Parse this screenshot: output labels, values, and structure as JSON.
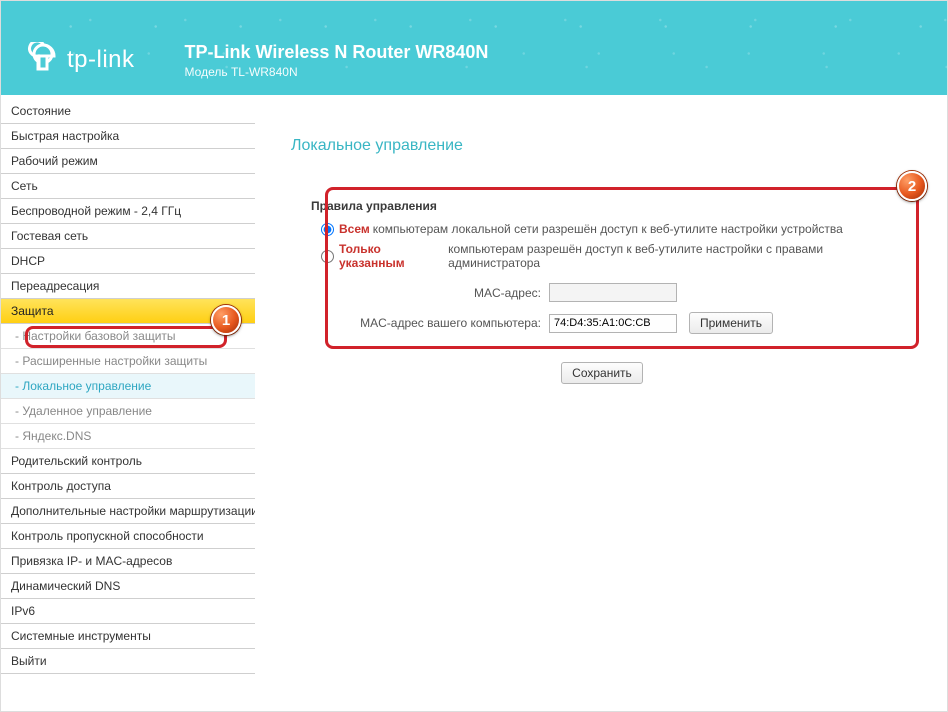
{
  "header": {
    "logo_text": "tp-link",
    "title": "TP-Link Wireless N Router WR840N",
    "subtitle": "Модель TL-WR840N"
  },
  "sidebar": {
    "items": [
      {
        "label": "Состояние",
        "type": "top"
      },
      {
        "label": "Быстрая настройка",
        "type": "top"
      },
      {
        "label": "Рабочий режим",
        "type": "top"
      },
      {
        "label": "Сеть",
        "type": "top"
      },
      {
        "label": "Беспроводной режим - 2,4 ГГц",
        "type": "top"
      },
      {
        "label": "Гостевая сеть",
        "type": "top"
      },
      {
        "label": "DHCP",
        "type": "top"
      },
      {
        "label": "Переадресация",
        "type": "top"
      },
      {
        "label": "Защита",
        "type": "top",
        "active_parent": true
      },
      {
        "label": "Настройки базовой защиты",
        "type": "sub"
      },
      {
        "label": "Расширенные настройки защиты",
        "type": "sub"
      },
      {
        "label": "Локальное управление",
        "type": "sub",
        "selected": true
      },
      {
        "label": "Удаленное управление",
        "type": "sub"
      },
      {
        "label": "Яндекс.DNS",
        "type": "sub"
      },
      {
        "label": "Родительский контроль",
        "type": "top"
      },
      {
        "label": "Контроль доступа",
        "type": "top"
      },
      {
        "label": "Дополнительные настройки маршрутизации",
        "type": "top"
      },
      {
        "label": "Контроль пропускной способности",
        "type": "top"
      },
      {
        "label": "Привязка IP- и MAC-адресов",
        "type": "top"
      },
      {
        "label": "Динамический DNS",
        "type": "top"
      },
      {
        "label": "IPv6",
        "type": "top"
      },
      {
        "label": "Системные инструменты",
        "type": "top"
      },
      {
        "label": "Выйти",
        "type": "top"
      }
    ]
  },
  "main": {
    "page_title": "Локальное управление",
    "section_title": "Правила управления",
    "radio_all_highlight": "Всем",
    "radio_all_rest": " компьютерам локальной сети разрешён доступ к веб-утилите настройки устройства",
    "radio_only_highlight": "Только указанным",
    "radio_only_rest": " компьютерам разрешён доступ к веб-утилите настройки с правами администратора",
    "mac_label": "MAC-адрес:",
    "mac_value": "",
    "your_mac_label": "MAC-адрес вашего компьютера:",
    "your_mac_value": "74:D4:35:A1:0C:CB",
    "apply_label": "Применить",
    "save_label": "Сохранить"
  },
  "annotations": {
    "badge1": "1",
    "badge2": "2"
  }
}
